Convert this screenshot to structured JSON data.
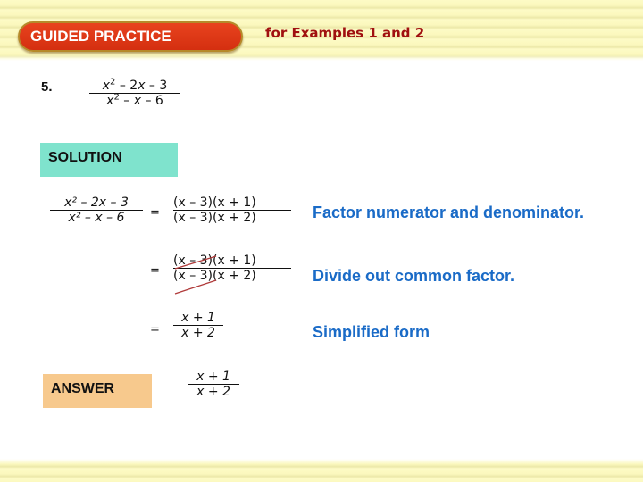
{
  "header": {
    "banner_title": "GUIDED PRACTICE",
    "examples_label": "for Examples 1 and 2"
  },
  "problem": {
    "number": "5.",
    "numerator": {
      "a": "x",
      "exp": "2",
      "rest": " – 2",
      "b": "x",
      "tail": " – 3"
    },
    "denominator": {
      "a": "x",
      "exp": "2",
      "rest": " – ",
      "b": "x",
      "tail": " – 6"
    }
  },
  "solution": {
    "label": "SOLUTION",
    "steps": [
      {
        "lhs_num": "x² – 2x – 3",
        "lhs_den": "x² – x – 6",
        "eq": "=",
        "num": "(x – 3)(x + 1)",
        "den": "(x – 3)(x + 2)",
        "note": "Factor numerator and denominator."
      },
      {
        "eq": "=",
        "num": "(x – 3)(x + 1)",
        "den": "(x – 3)(x + 2)",
        "note": "Divide out common factor.",
        "struck_factor": "(x – 3)"
      },
      {
        "eq": "=",
        "num": "x + 1",
        "den": "x + 2",
        "note": "Simplified form"
      }
    ]
  },
  "answer": {
    "label": "ANSWER",
    "num": "x + 1",
    "den": "x + 2"
  },
  "colors": {
    "banner": "#d9360f",
    "solution_box": "#7fe3cd",
    "answer_box": "#f7c98d",
    "note_text": "#1a6bc7",
    "examples_text": "#a01010",
    "strike": "#b03a3a"
  }
}
